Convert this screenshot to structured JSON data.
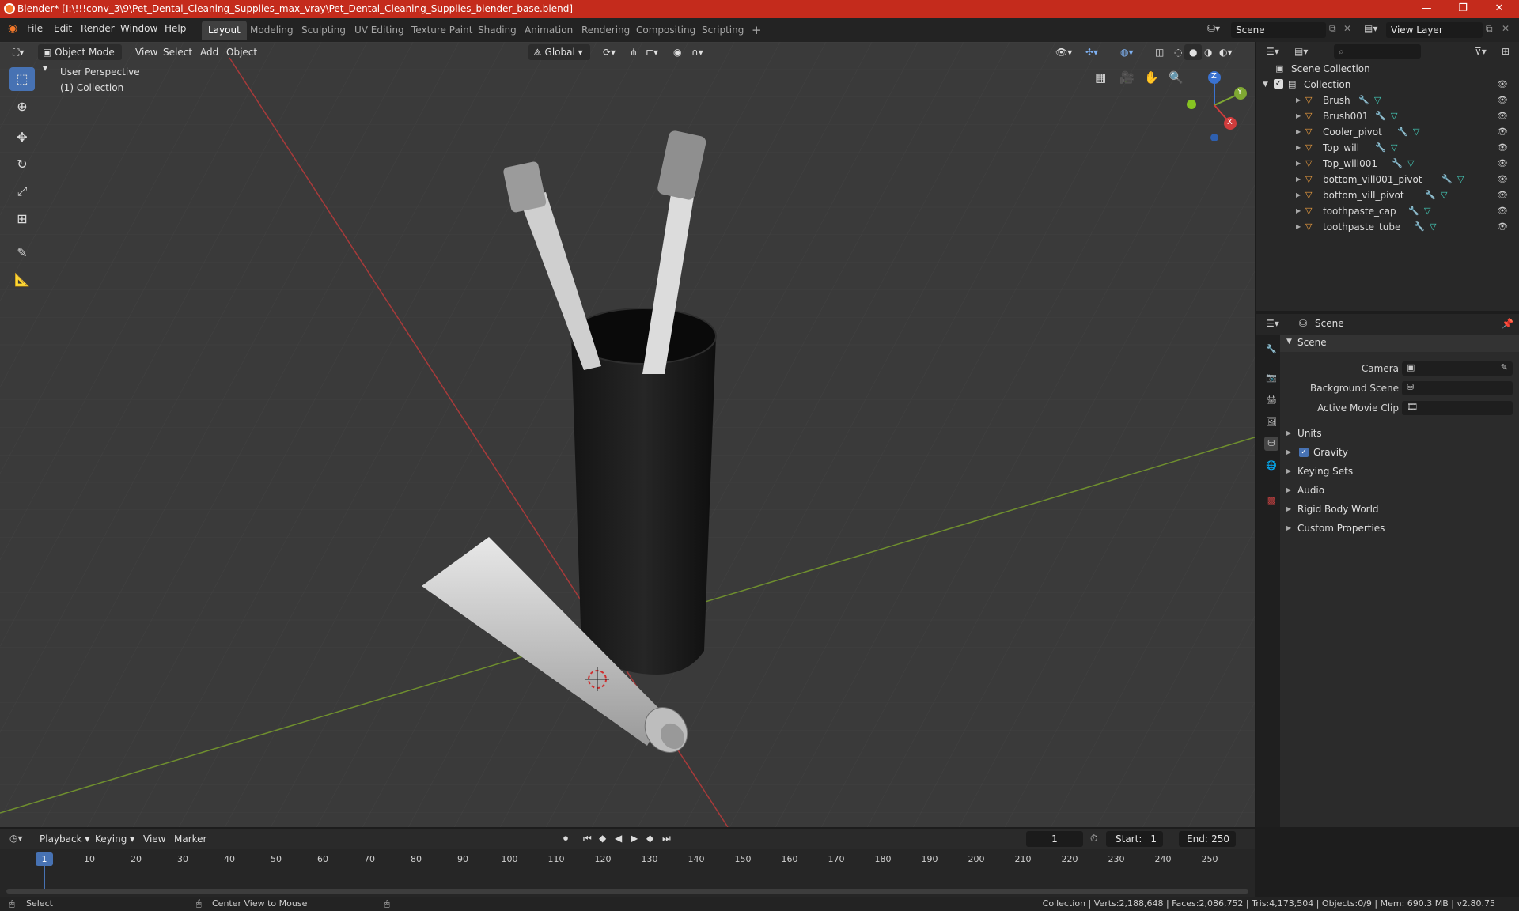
{
  "window": {
    "title": "Blender* [I:\\!!!conv_3\\9\\Pet_Dental_Cleaning_Supplies_max_vray\\Pet_Dental_Cleaning_Supplies_blender_base.blend]",
    "minimize": "—",
    "maximize": "❐",
    "close": "✕"
  },
  "menus": [
    "File",
    "Edit",
    "Render",
    "Window",
    "Help"
  ],
  "workspaces": [
    "Layout",
    "Modeling",
    "Sculpting",
    "UV Editing",
    "Texture Paint",
    "Shading",
    "Animation",
    "Rendering",
    "Compositing",
    "Scripting"
  ],
  "active_workspace": "Layout",
  "add_workspace": "+",
  "scene_field": "Scene",
  "view_layer_field": "View Layer",
  "viewport_header": {
    "mode": "Object Mode",
    "menus": [
      "View",
      "Select",
      "Add",
      "Object"
    ],
    "orientation": "Global"
  },
  "viewport_overlay": {
    "perspective": "User Perspective",
    "collection": "(1) Collection"
  },
  "gizmo": {
    "z": "Z",
    "y": "Y",
    "x": "X"
  },
  "outliner": {
    "root": "Scene Collection",
    "collection": "Collection",
    "objects": [
      "Brush",
      "Brush001",
      "Cooler_pivot",
      "Top_will",
      "Top_will001",
      "bottom_vill001_pivot",
      "bottom_vill_pivot",
      "toothpaste_cap",
      "toothpaste_tube"
    ]
  },
  "properties": {
    "context": "Scene",
    "section": "Scene",
    "camera_label": "Camera",
    "background_scene_label": "Background Scene",
    "active_movie_clip_label": "Active Movie Clip",
    "panels": [
      "Units",
      "Gravity",
      "Keying Sets",
      "Audio",
      "Rigid Body World",
      "Custom Properties"
    ],
    "gravity_checked": true
  },
  "timeline": {
    "menus": [
      "Playback",
      "Keying",
      "View",
      "Marker"
    ],
    "current_frame": "1",
    "start_label": "Start:",
    "start": "1",
    "end_label": "End:",
    "end": "250",
    "ticks": [
      "10",
      "20",
      "30",
      "40",
      "50",
      "60",
      "70",
      "80",
      "90",
      "100",
      "110",
      "120",
      "130",
      "140",
      "150",
      "160",
      "170",
      "180",
      "190",
      "200",
      "210",
      "220",
      "230",
      "240",
      "250"
    ],
    "playhead": "1"
  },
  "statusbar": {
    "select": "Select",
    "center_view": "Center View to Mouse",
    "stats": "Collection | Verts:2,188,648 | Faces:2,086,752 | Tris:4,173,504 | Objects:0/9 | Mem: 690.3 MB | v2.80.75"
  }
}
